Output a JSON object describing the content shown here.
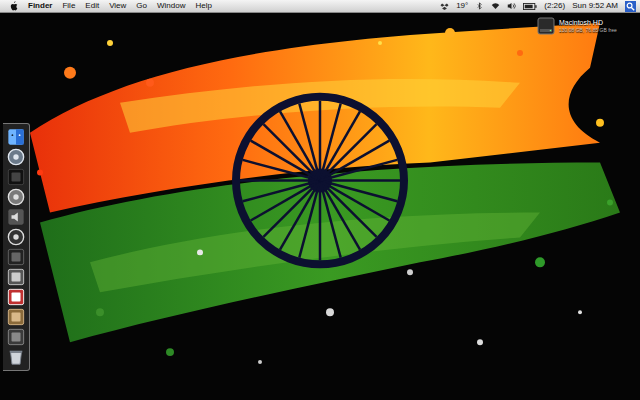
{
  "menu_bar": {
    "app": "Finder",
    "menus": [
      "File",
      "Edit",
      "View",
      "Go",
      "Window",
      "Help"
    ],
    "status": {
      "weather": "19°",
      "battery": "(2:26)",
      "clock": "Sun 9:52 AM"
    }
  },
  "desktop_icons": [
    {
      "label": "Macintosh HD",
      "info": "130.08 GB, 76.85 GB free",
      "selected": false
    }
  ]
}
